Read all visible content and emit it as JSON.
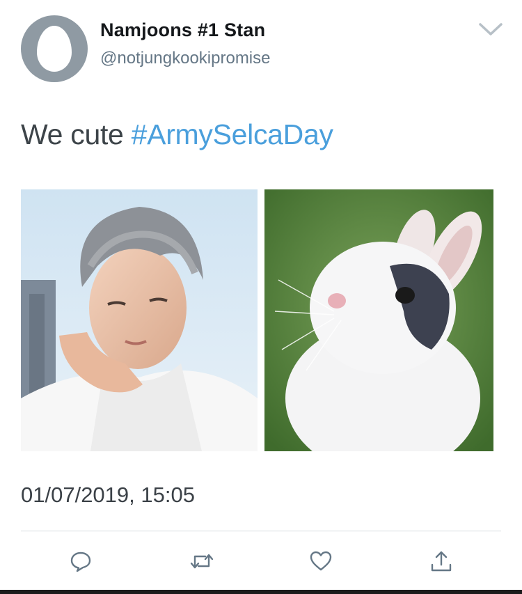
{
  "user": {
    "display_name": "Namjoons #1 Stan",
    "handle": "@notjungkookipromise"
  },
  "tweet": {
    "text_prefix": "We cute ",
    "hashtag": "#ArmySelcaDay",
    "timestamp": "01/07/2019, 15:05"
  },
  "media": [
    {
      "subject": "portrait photo of a man with grey hair"
    },
    {
      "subject": "photo of a white rabbit"
    }
  ],
  "actions": {
    "reply_icon": "speech-bubble",
    "retweet_icon": "retweet-arrows",
    "like_icon": "heart",
    "share_icon": "upload-arrow"
  },
  "colors": {
    "hashtag": "#4a9fdc",
    "icon": "#657786",
    "avatar_bg": "#8f9aa3"
  }
}
